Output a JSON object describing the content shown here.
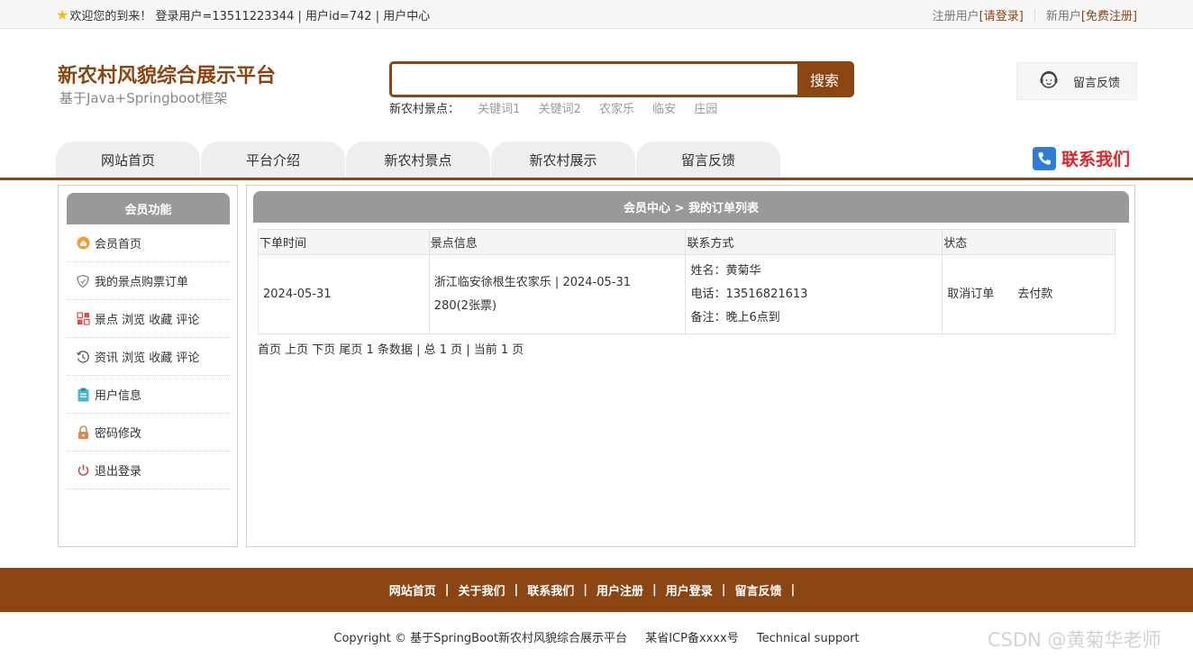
{
  "topbar": {
    "welcome": "欢迎您的到来！ 登录用户=13511223344 | 用户id=742 | 用户中心",
    "registered_label": "注册用户",
    "login_link": "[请登录]",
    "new_user_label": "新用户",
    "register_link": "[免费注册]"
  },
  "header": {
    "title": "新农村风貌综合展示平台",
    "subtitle": "基于Java+Springboot框架",
    "search": {
      "placeholder": "",
      "button": "搜索"
    },
    "hot_label": "新农村景点：",
    "hot_words": [
      "关键词1",
      "关键词2",
      "农家乐",
      "临安",
      "庄园"
    ],
    "feedback_label": "留言反馈"
  },
  "nav": {
    "items": [
      "网站首页",
      "平台介绍",
      "新农村景点",
      "新农村展示",
      "留言反馈"
    ],
    "contact": "联系我们"
  },
  "sidebar": {
    "title": "会员功能",
    "items": [
      {
        "label": "会员首页",
        "icon": "home-icon",
        "color": "#f39c34"
      },
      {
        "label": "我的景点购票订单",
        "icon": "shield-icon",
        "color": "#888888"
      },
      {
        "label": "景点 浏览 收藏 评论",
        "icon": "grid-icon",
        "color": "#e54b4b"
      },
      {
        "label": "资讯 浏览 收藏 评论",
        "icon": "history-icon",
        "color": "#555555"
      },
      {
        "label": "用户信息",
        "icon": "clipboard-icon",
        "color": "#4ab6d0"
      },
      {
        "label": "密码修改",
        "icon": "lock-icon",
        "color": "#e0884a"
      },
      {
        "label": "退出登录",
        "icon": "power-icon",
        "color": "#c0504d"
      }
    ]
  },
  "main": {
    "title": "会员中心 > 我的订单列表",
    "columns": [
      "下单时间",
      "景点信息",
      "联系方式",
      "状态"
    ],
    "rows": [
      {
        "time": "2024-05-31",
        "info_line1": "浙江临安徐根生农家乐 | 2024-05-31",
        "info_line2": "280(2张票)",
        "name": "姓名：黄菊华",
        "phone": "电话：13516821613",
        "note": "备注：晚上6点到",
        "action_cancel": "取消订单",
        "action_pay": "去付款"
      }
    ],
    "pager": "首页 上页 下页 尾页 1 条数据 | 总 1 页 | 当前 1 页"
  },
  "footer": {
    "links": [
      "网站首页",
      "关于我们",
      "联系我们",
      "用户注册",
      "用户登录",
      "留言反馈"
    ],
    "copyright": "Copyright © 基于SpringBoot新农村风貌综合展示平台",
    "icp": "某省ICP备xxxx号",
    "support": "Technical support"
  },
  "watermark": "CSDN @黄菊华老师",
  "colors": {
    "brand": "#8b4513",
    "panel_header": "#999999",
    "contact_red": "#e0262b"
  }
}
